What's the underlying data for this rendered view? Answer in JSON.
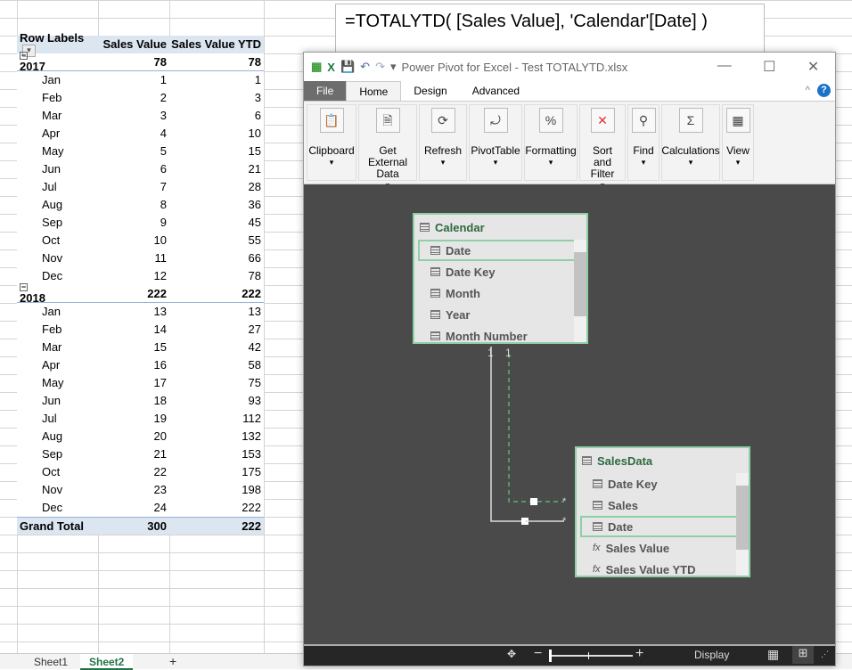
{
  "formula": "=TOTALYTD(  [Sales Value],   'Calendar'[Date]   )",
  "pivot": {
    "headers": [
      "Row Labels",
      "Sales Value",
      "Sales Value YTD"
    ],
    "years": [
      {
        "label": "2017",
        "value": "78",
        "ytd": "78",
        "months": [
          [
            "Jan",
            "1",
            "1"
          ],
          [
            "Feb",
            "2",
            "3"
          ],
          [
            "Mar",
            "3",
            "6"
          ],
          [
            "Apr",
            "4",
            "10"
          ],
          [
            "May",
            "5",
            "15"
          ],
          [
            "Jun",
            "6",
            "21"
          ],
          [
            "Jul",
            "7",
            "28"
          ],
          [
            "Aug",
            "8",
            "36"
          ],
          [
            "Sep",
            "9",
            "45"
          ],
          [
            "Oct",
            "10",
            "55"
          ],
          [
            "Nov",
            "11",
            "66"
          ],
          [
            "Dec",
            "12",
            "78"
          ]
        ]
      },
      {
        "label": "2018",
        "value": "222",
        "ytd": "222",
        "months": [
          [
            "Jan",
            "13",
            "13"
          ],
          [
            "Feb",
            "14",
            "27"
          ],
          [
            "Mar",
            "15",
            "42"
          ],
          [
            "Apr",
            "16",
            "58"
          ],
          [
            "May",
            "17",
            "75"
          ],
          [
            "Jun",
            "18",
            "93"
          ],
          [
            "Jul",
            "19",
            "112"
          ],
          [
            "Aug",
            "20",
            "132"
          ],
          [
            "Sep",
            "21",
            "153"
          ],
          [
            "Oct",
            "22",
            "175"
          ],
          [
            "Nov",
            "23",
            "198"
          ],
          [
            "Dec",
            "24",
            "222"
          ]
        ]
      }
    ],
    "grand_total": {
      "label": "Grand Total",
      "value": "300",
      "ytd": "222"
    }
  },
  "sheets": {
    "tabs": [
      "Sheet1",
      "Sheet2"
    ],
    "active": "Sheet2",
    "add": "+"
  },
  "window": {
    "title": "Power Pivot for Excel - Test TOTALYTD.xlsx",
    "tabs": [
      "File",
      "Home",
      "Design",
      "Advanced"
    ],
    "ribbon": [
      {
        "label": "Clipboard",
        "icon": "clipboard-icon",
        "glyph": "📋"
      },
      {
        "label": "Get External Data",
        "icon": "database-icon",
        "glyph": "🗎"
      },
      {
        "label": "Refresh",
        "icon": "refresh-icon",
        "glyph": "⟳"
      },
      {
        "label": "PivotTable",
        "icon": "pivottable-icon",
        "glyph": "⤾"
      },
      {
        "label": "Formatting",
        "icon": "percent-icon",
        "glyph": "%"
      },
      {
        "label": "Sort and Filter",
        "icon": "filter-icon",
        "glyph": "✕"
      },
      {
        "label": "Find",
        "icon": "binoculars-icon",
        "glyph": "⚲"
      },
      {
        "label": "Calculations",
        "icon": "sigma-icon",
        "glyph": "Σ"
      },
      {
        "label": "View",
        "icon": "grid-icon",
        "glyph": "▦"
      }
    ],
    "calendar": {
      "name": "Calendar",
      "fields": [
        "Date",
        "Date Key",
        "Month",
        "Year",
        "Month Number"
      ],
      "selected": "Date"
    },
    "salesdata": {
      "name": "SalesData",
      "fields": [
        "Date Key",
        "Sales",
        "Date",
        "Sales Value",
        "Sales Value YTD"
      ],
      "selected": "Date",
      "measures": [
        "Sales Value",
        "Sales Value YTD"
      ]
    },
    "relationship": {
      "from_card": "1",
      "to_card": "*"
    },
    "status": {
      "display": "Display",
      "zoom_minus": "−",
      "zoom_plus": "+"
    },
    "accent": "#8fcfa5"
  }
}
